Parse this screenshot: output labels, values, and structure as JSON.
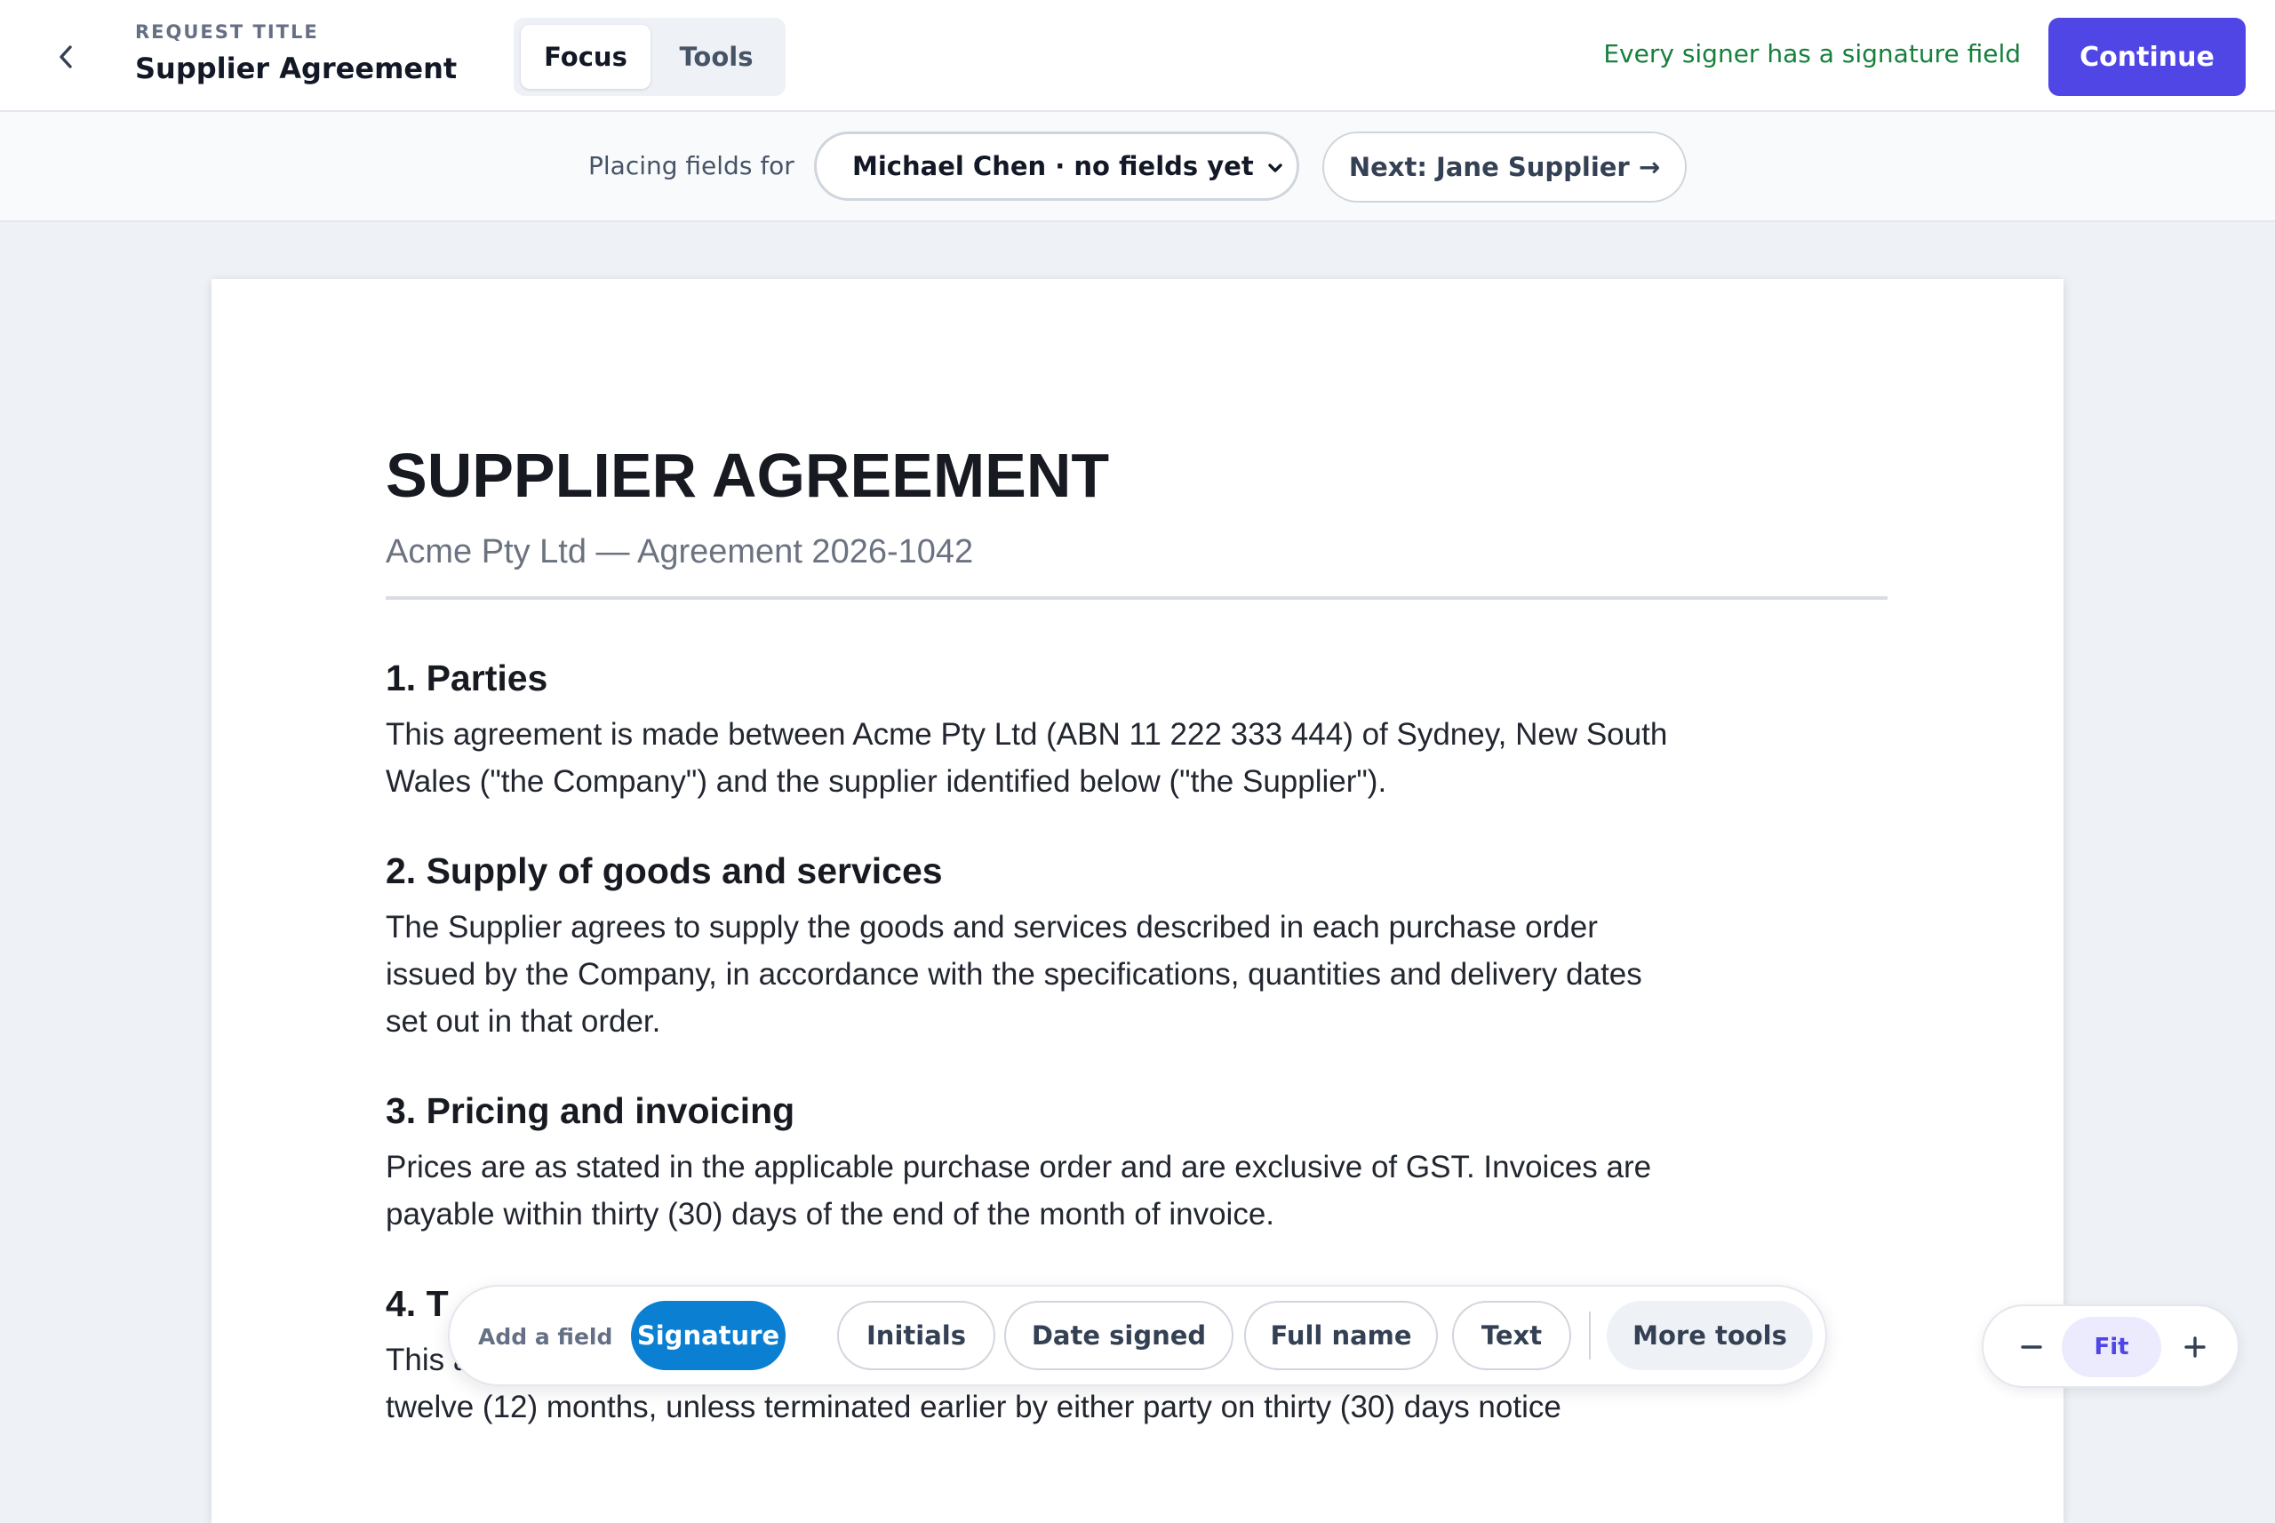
{
  "header": {
    "back_icon": "chevron-left-icon",
    "title_label": "REQUEST TITLE",
    "title": "Supplier Agreement",
    "modes": [
      {
        "label": "Focus",
        "active": true
      },
      {
        "label": "Tools",
        "active": false
      }
    ],
    "status": "Every signer has a signature field",
    "status_color": "#16803c",
    "continue_label": "Continue",
    "accent_color": "#4f46e5"
  },
  "signer_bar": {
    "label": "Placing fields for",
    "selected_signer": "Michael Chen · no fields yet",
    "next_label": "Next: Jane Supplier →"
  },
  "document": {
    "title": "SUPPLIER AGREEMENT",
    "subtitle": "Acme Pty Ltd — Agreement 2026-1042",
    "sections": [
      {
        "heading": "1. Parties",
        "body": "This agreement is made between Acme Pty Ltd (ABN 11 222 333 444) of Sydney, New South Wales (\"the Company\") and the supplier identified below (\"the Supplier\")."
      },
      {
        "heading": "2. Supply of goods and services",
        "body": "The Supplier agrees to supply the goods and services described in each purchase order issued by the Company, in accordance with the specifications, quantities and delivery dates set out in that order."
      },
      {
        "heading": "3. Pricing and invoicing",
        "body": "Prices are as stated in the applicable purchase order and are exclusive of GST. Invoices are payable within thirty (30) days of the end of the month of invoice."
      },
      {
        "heading": "4. T",
        "body": "This a"
      }
    ],
    "partial_line": "twelve (12) months, unless terminated earlier by either party on thirty (30) days notice"
  },
  "toolbar": {
    "label": "Add a field",
    "fields": [
      "Signature",
      "Initials",
      "Date signed",
      "Full name",
      "Text"
    ],
    "more_label": "More tools",
    "primary_color": "#0b7fd1"
  },
  "zoom": {
    "fit_label": "Fit",
    "minus_icon": "minus-icon",
    "plus_icon": "plus-icon"
  }
}
